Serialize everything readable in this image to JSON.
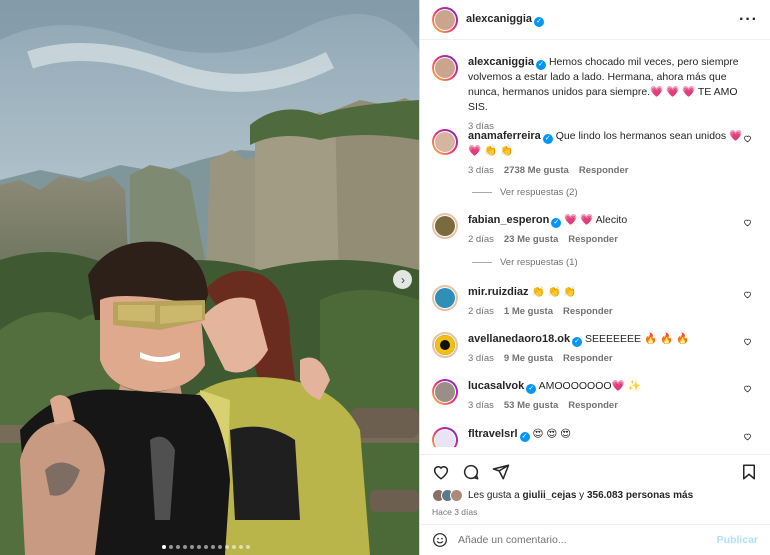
{
  "post": {
    "username": "alexcaniggia",
    "more_icon": "more-horizontal-icon",
    "carousel_next_icon": "chevron-right-icon",
    "carousel_total": 13,
    "carousel_current": 1
  },
  "caption": {
    "username": "alexcaniggia",
    "text": "Hemos chocado mil veces, pero siempre volvemos a estar lado a lado. Hermana, ahora más que nunca, hermanos unidos para siempre.💗 💗 💗  TE AMO SIS.",
    "time": "3 días"
  },
  "comments": [
    {
      "username": "anamaferreira",
      "verified": true,
      "text": "Que lindo los hermanos sean unidos 💗 💗 👏 👏",
      "time": "3 días",
      "likes": "2738 Me gusta",
      "reply": "Responder",
      "replies": "Ver respuestas (2)"
    },
    {
      "username": "fabian_esperon",
      "verified": true,
      "text": "💗 💗  Alecito",
      "time": "2 días",
      "likes": "23 Me gusta",
      "reply": "Responder",
      "replies": "Ver respuestas (1)"
    },
    {
      "username": "mir.ruizdiaz",
      "verified": false,
      "text": "👏 👏 👏",
      "time": "2 días",
      "likes": "1 Me gusta",
      "reply": "Responder"
    },
    {
      "username": "avellanedaoro18.ok",
      "verified": true,
      "text": "SEEEEEEE 🔥 🔥 🔥",
      "time": "3 días",
      "likes": "9 Me gusta",
      "reply": "Responder"
    },
    {
      "username": "lucasalvok",
      "verified": true,
      "text": "AMOOOOOOO💗 ✨",
      "time": "3 días",
      "likes": "53 Me gusta",
      "reply": "Responder"
    },
    {
      "username": "fltravelsrl",
      "verified": true,
      "text": "😍 😍 😍",
      "time": "",
      "likes": "",
      "reply": ""
    }
  ],
  "likes_line": {
    "prefix": "Les gusta a ",
    "user": "giulii_cejas",
    "middle": " y ",
    "count": "356.083 personas más"
  },
  "posted_ago": "Hace 3 días",
  "composer": {
    "placeholder": "Añade un comentario...",
    "publish": "Publicar",
    "emoji_icon": "smiley-icon"
  },
  "colors": {
    "verified": "#0095f6",
    "publish_disabled": "#b2dffc",
    "secondary_text": "#737373"
  }
}
